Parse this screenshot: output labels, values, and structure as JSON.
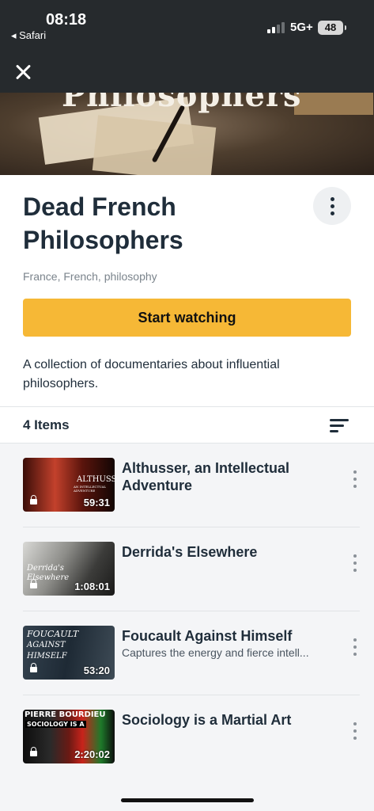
{
  "status_bar": {
    "time": "08:18",
    "back_app": "◂ Safari",
    "network": "5G+",
    "battery": "48"
  },
  "hero": {
    "banner_text": "Philosophers",
    "banner_gold": "rs"
  },
  "collection": {
    "title": "Dead French Philosophers",
    "tags": "France, French, philosophy",
    "start_button": "Start watching",
    "description": "A collection of documentaries about influential philosophers."
  },
  "list_header": {
    "count": "4 Items"
  },
  "items": [
    {
      "title": "Althusser, an Intellectual Adventure",
      "subtitle": "",
      "duration": "59:31",
      "thumb_caption": "ALTHUSSER",
      "thumb_subcaption": "AN INTELLECTUAL ADVENTURE"
    },
    {
      "title": "Derrida's Elsewhere",
      "subtitle": "",
      "duration": "1:08:01",
      "thumb_caption": "Derrida's",
      "thumb_subcaption": "Elsewhere"
    },
    {
      "title": "Foucault Against Himself",
      "subtitle": "Captures the energy and fierce intell...",
      "duration": "53:20",
      "thumb_caption": "FOUCAULT",
      "thumb_subcaption": "AGAINST HIMSELF"
    },
    {
      "title": "Sociology is a Martial Art",
      "subtitle": "",
      "duration": "2:20:02",
      "thumb_caption": "PIERRE BOURDIEU",
      "thumb_subcaption": "SOCIOLOGY IS A"
    }
  ],
  "colors": {
    "accent": "#f6b836",
    "header_bg": "#262a2d",
    "text": "#1f2d3a"
  }
}
